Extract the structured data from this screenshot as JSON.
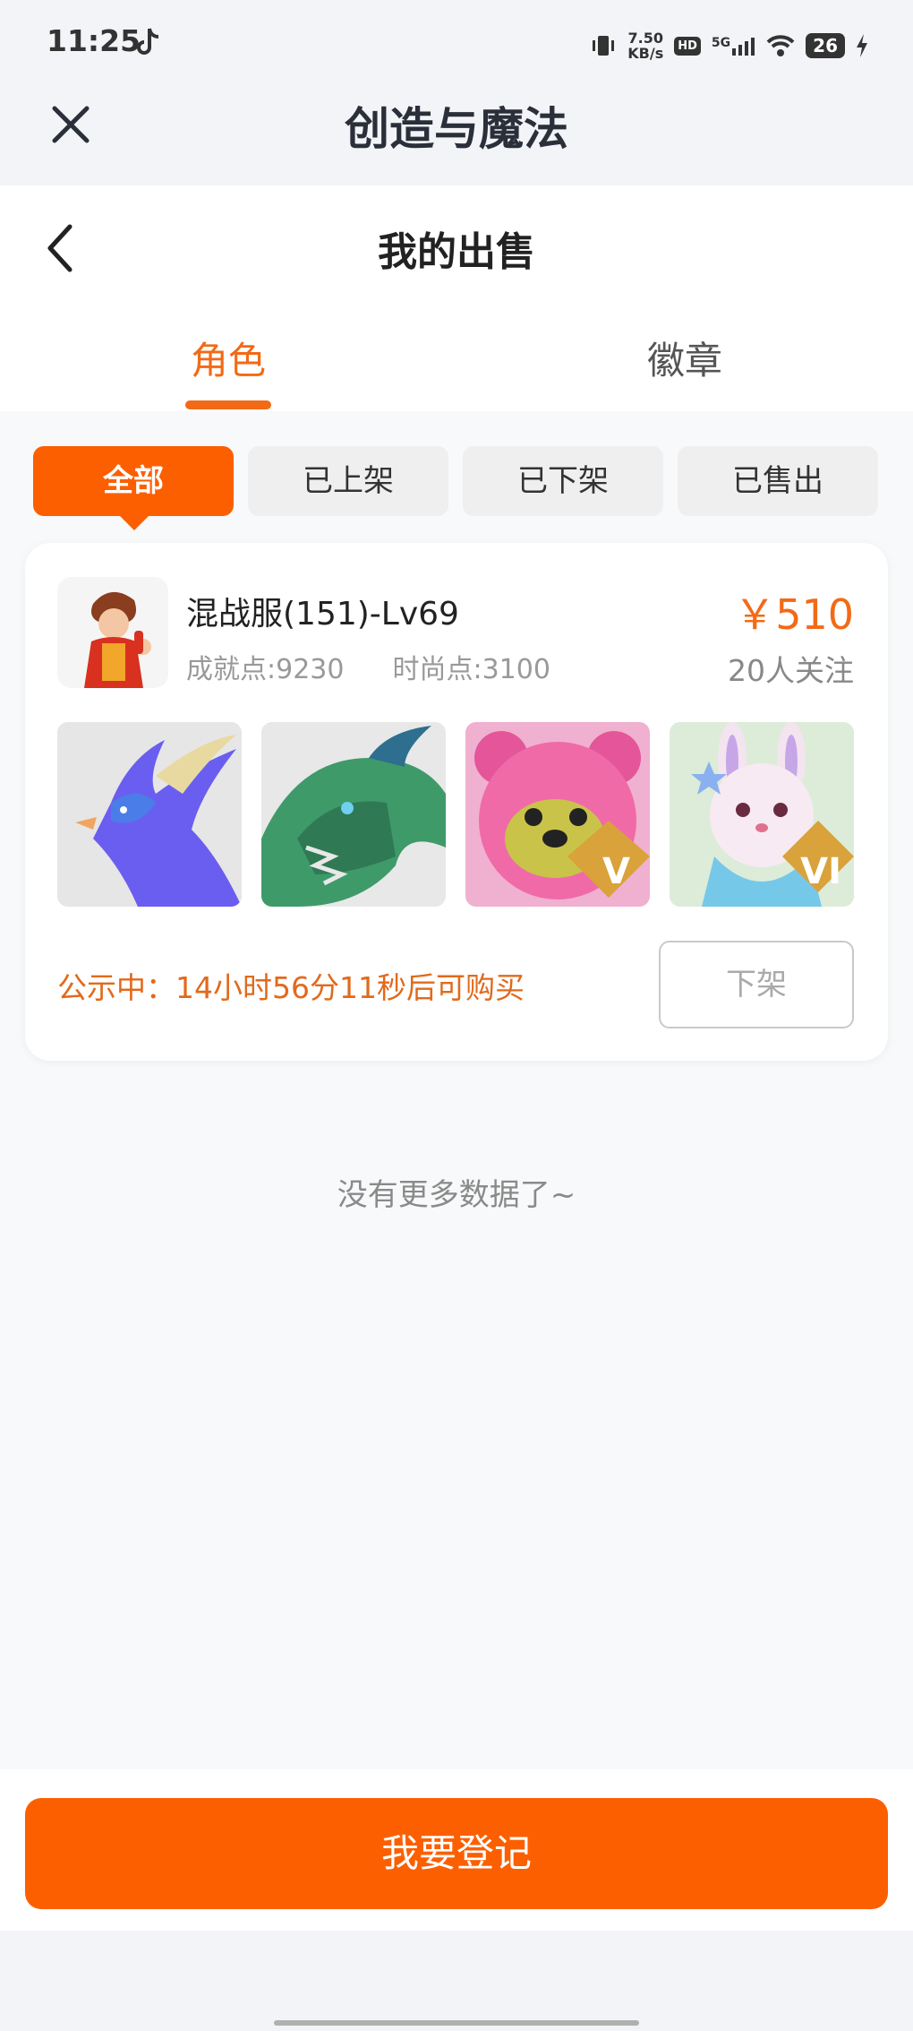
{
  "status_bar": {
    "time": "11:25",
    "net_speed_value": "7.50",
    "net_speed_unit": "KB/s",
    "hd": "HD",
    "signal": "5G",
    "battery": "26"
  },
  "header": {
    "app_title": "创造与魔法",
    "page_title": "我的出售"
  },
  "tabs": [
    {
      "label": "角色",
      "active": true
    },
    {
      "label": "徽章",
      "active": false
    }
  ],
  "filters": [
    {
      "label": "全部",
      "active": true
    },
    {
      "label": "已上架",
      "active": false
    },
    {
      "label": "已下架",
      "active": false
    },
    {
      "label": "已售出",
      "active": false
    }
  ],
  "listing": {
    "name": "混战服(151)-Lv69",
    "achievement": "成就点:9230",
    "fashion": "时尚点:3100",
    "price": "￥510",
    "followers": "20人关注",
    "notice": "公示中：14小时56分11秒后可购买",
    "action_label": "下架",
    "thumbnails": [
      {
        "icon": "blue-phoenix-mount",
        "rank": ""
      },
      {
        "icon": "green-dragon-mount",
        "rank": ""
      },
      {
        "icon": "pink-bear-pet",
        "rank": "V"
      },
      {
        "icon": "white-rabbit-pet",
        "rank": "VI"
      }
    ]
  },
  "footer_text": "没有更多数据了~",
  "register_label": "我要登记",
  "colors": {
    "accent": "#fc5f00",
    "accent_text": "#f26a16",
    "notice": "#e16a1c"
  }
}
